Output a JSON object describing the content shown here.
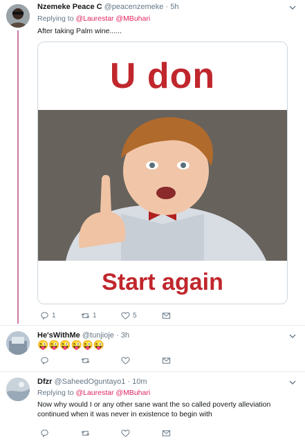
{
  "tweets": [
    {
      "name": "Nzemeke Peace C",
      "handle": "@peacenzemeke",
      "time": "5h",
      "reply_prefix": "Replying to",
      "mentions": [
        "@Laurestar",
        "@MBuhari"
      ],
      "text": "After taking Palm wine......",
      "media": {
        "top_text": "U don",
        "bottom_text": "Start again"
      },
      "actions": {
        "replies": "1",
        "retweets": "1",
        "likes": "5"
      }
    },
    {
      "name": "He'sWithMe",
      "handle": "@tunjioje",
      "time": "3h",
      "text": "😜😜😜😜😜😜",
      "actions": {
        "replies": "",
        "retweets": "",
        "likes": ""
      }
    },
    {
      "name": "Dfzr",
      "handle": "@SaheedOguntayo1",
      "time": "10m",
      "reply_prefix": "Replying to",
      "mentions": [
        "@Laurestar",
        "@MBuhari"
      ],
      "text": "Now why would I or any other sane want the so called poverty alleviation continued when it was never in existence to begin with",
      "actions": {
        "replies": "",
        "retweets": "",
        "likes": ""
      }
    }
  ],
  "separator": "·",
  "colors": {
    "mention": "#e0245e",
    "thread_line": "#cc79a7",
    "meme_text": "#c0272d",
    "secondary": "#657786"
  },
  "icons": [
    "reply-icon",
    "retweet-icon",
    "like-icon",
    "message-icon",
    "chevron-down-icon"
  ]
}
